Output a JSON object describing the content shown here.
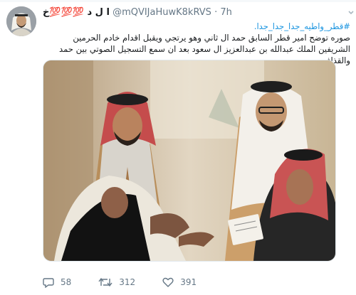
{
  "tweet": {
    "display_name": "ا ل د 💯💯💯خ",
    "handle": "@mQVIJaHuwK8kRVS",
    "separator": "·",
    "time": "7h",
    "hashtag": "#قطر_واطيه_جدا_جدا_جدا.",
    "text": "صوره توضح امير قطر السابق حمد ال ثاني وهو يرتجي ويقبل اقدام خادم الحرمين الشريفين الملك عبدالله بن عبدالعزيز ال سعود بعد ان سمع التسجيل الصوتي بين حمد والقذافي",
    "replies": "58",
    "retweets": "312",
    "likes": "391"
  },
  "icons": {
    "reply": "reply-icon",
    "retweet": "retweet-icon",
    "like": "heart-icon",
    "more": "ellipsis-icon"
  },
  "colors": {
    "link": "#1b95e0",
    "muted": "#657786",
    "shemagh_red": "#c23a3a"
  }
}
